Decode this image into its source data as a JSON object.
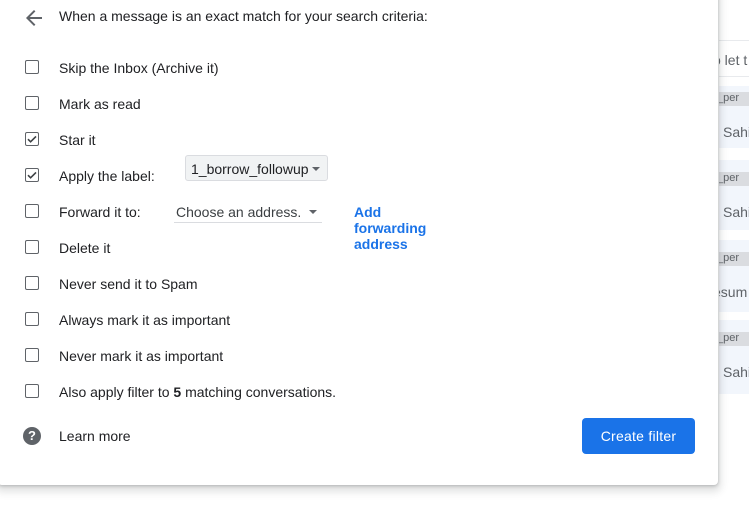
{
  "dialog": {
    "header": "When a message is an exact match for your search criteria:",
    "options": [
      {
        "label": "Skip the Inbox (Archive it)",
        "checked": false
      },
      {
        "label": "Mark as read",
        "checked": false
      },
      {
        "label": "Star it",
        "checked": true
      },
      {
        "label": "Apply the label:",
        "checked": true,
        "select_value": "1_borrow_followup"
      },
      {
        "label": "Forward it to:",
        "checked": false,
        "select_value": "Choose an address.",
        "link": "Add forwarding address"
      },
      {
        "label": "Delete it",
        "checked": false
      },
      {
        "label": "Never send it to Spam",
        "checked": false
      },
      {
        "label": "Always mark it as important",
        "checked": false
      },
      {
        "label": "Never mark it as important",
        "checked": false
      },
      {
        "label_prefix": "Also apply filter to ",
        "count": "5",
        "label_suffix": " matching conversations.",
        "checked": false
      }
    ],
    "learn_more": "Learn more",
    "create_button": "Create filter",
    "accent_color": "#1a73e8"
  },
  "background_list": {
    "fragments": [
      "o let t",
      "_per",
      "Sahi",
      "_per",
      "Sahi",
      "_per",
      "esum",
      "_per",
      "Sahi"
    ]
  }
}
